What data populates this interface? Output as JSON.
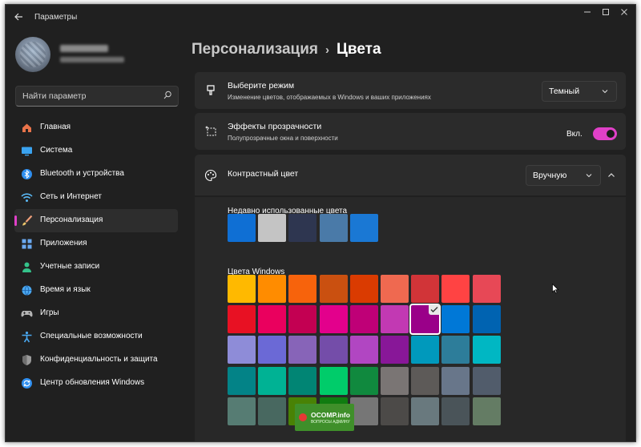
{
  "window": {
    "title": "Параметры",
    "controls": [
      "minimize-icon",
      "maximize-icon",
      "close-icon"
    ]
  },
  "search": {
    "placeholder": "Найти параметр"
  },
  "nav": [
    {
      "label": "Главная",
      "icon": "home-icon",
      "color": "#e8734a"
    },
    {
      "label": "Система",
      "icon": "monitor-icon",
      "color": "#3aa3f0"
    },
    {
      "label": "Bluetooth и устройства",
      "icon": "bluetooth-icon",
      "color": "#2f8ff0"
    },
    {
      "label": "Сеть и Интернет",
      "icon": "wifi-icon",
      "color": "#5ab8f5"
    },
    {
      "label": "Персонализация",
      "icon": "brush-icon",
      "color": "#f0a07a",
      "active": true
    },
    {
      "label": "Приложения",
      "icon": "apps-icon",
      "color": "#6aa9f0"
    },
    {
      "label": "Учетные записи",
      "icon": "person-icon",
      "color": "#34c28a"
    },
    {
      "label": "Время и язык",
      "icon": "globe-icon",
      "color": "#4aa8f0"
    },
    {
      "label": "Игры",
      "icon": "gamepad-icon",
      "color": "#b5b5b5"
    },
    {
      "label": "Специальные возможности",
      "icon": "accessibility-icon",
      "color": "#4aa8f0"
    },
    {
      "label": "Конфиденциальность и защита",
      "icon": "shield-icon",
      "color": "#9a9a9a"
    },
    {
      "label": "Центр обновления Windows",
      "icon": "update-icon",
      "color": "#2f8ff0"
    }
  ],
  "breadcrumb": {
    "parent": "Персонализация",
    "separator": "›",
    "current": "Цвета"
  },
  "mode_card": {
    "title": "Выберите режим",
    "subtitle": "Изменение цветов, отображаемых в Windows и ваших приложениях",
    "value": "Темный"
  },
  "transparency_card": {
    "title": "Эффекты прозрачности",
    "subtitle": "Полупрозрачные окна и поверхности",
    "toggle_label": "Вкл.",
    "toggle_on": true
  },
  "accent_card": {
    "title": "Контрастный цвет",
    "value": "Вручную"
  },
  "recent_colors": {
    "label": "Недавно использованные цвета",
    "colors": [
      "#0f6fd4",
      "#c4c4c4",
      "#2e3650",
      "#4a7aa8",
      "#1a78d4"
    ]
  },
  "windows_colors": {
    "label": "Цвета Windows",
    "selected_index": 15,
    "colors": [
      "#ffb900",
      "#ff8c00",
      "#f7630c",
      "#ca5010",
      "#da3b01",
      "#ef6950",
      "#d13438",
      "#ff4343",
      "#e74856",
      "#e81123",
      "#ea005e",
      "#c30052",
      "#e3008c",
      "#bf0077",
      "#c239b3",
      "#9a0089",
      "#0078d7",
      "#0063b1",
      "#8e8cd8",
      "#6b69d6",
      "#8764b8",
      "#744da9",
      "#b146c2",
      "#881798",
      "#0099bc",
      "#2d7d9a",
      "#00b7c3",
      "#038387",
      "#00b294",
      "#018574",
      "#00cc6a",
      "#10893e",
      "#7a7574",
      "#5d5a58",
      "#68768a",
      "#515c6b",
      "#567c73",
      "#486860",
      "#498205",
      "#107c10",
      "#767676",
      "#4c4a48",
      "#69797e",
      "#4a5459",
      "#647c64"
    ]
  },
  "watermark": {
    "title": "OCOMP.info",
    "subtitle": "ВОПРОСЫ АДМИНУ"
  }
}
